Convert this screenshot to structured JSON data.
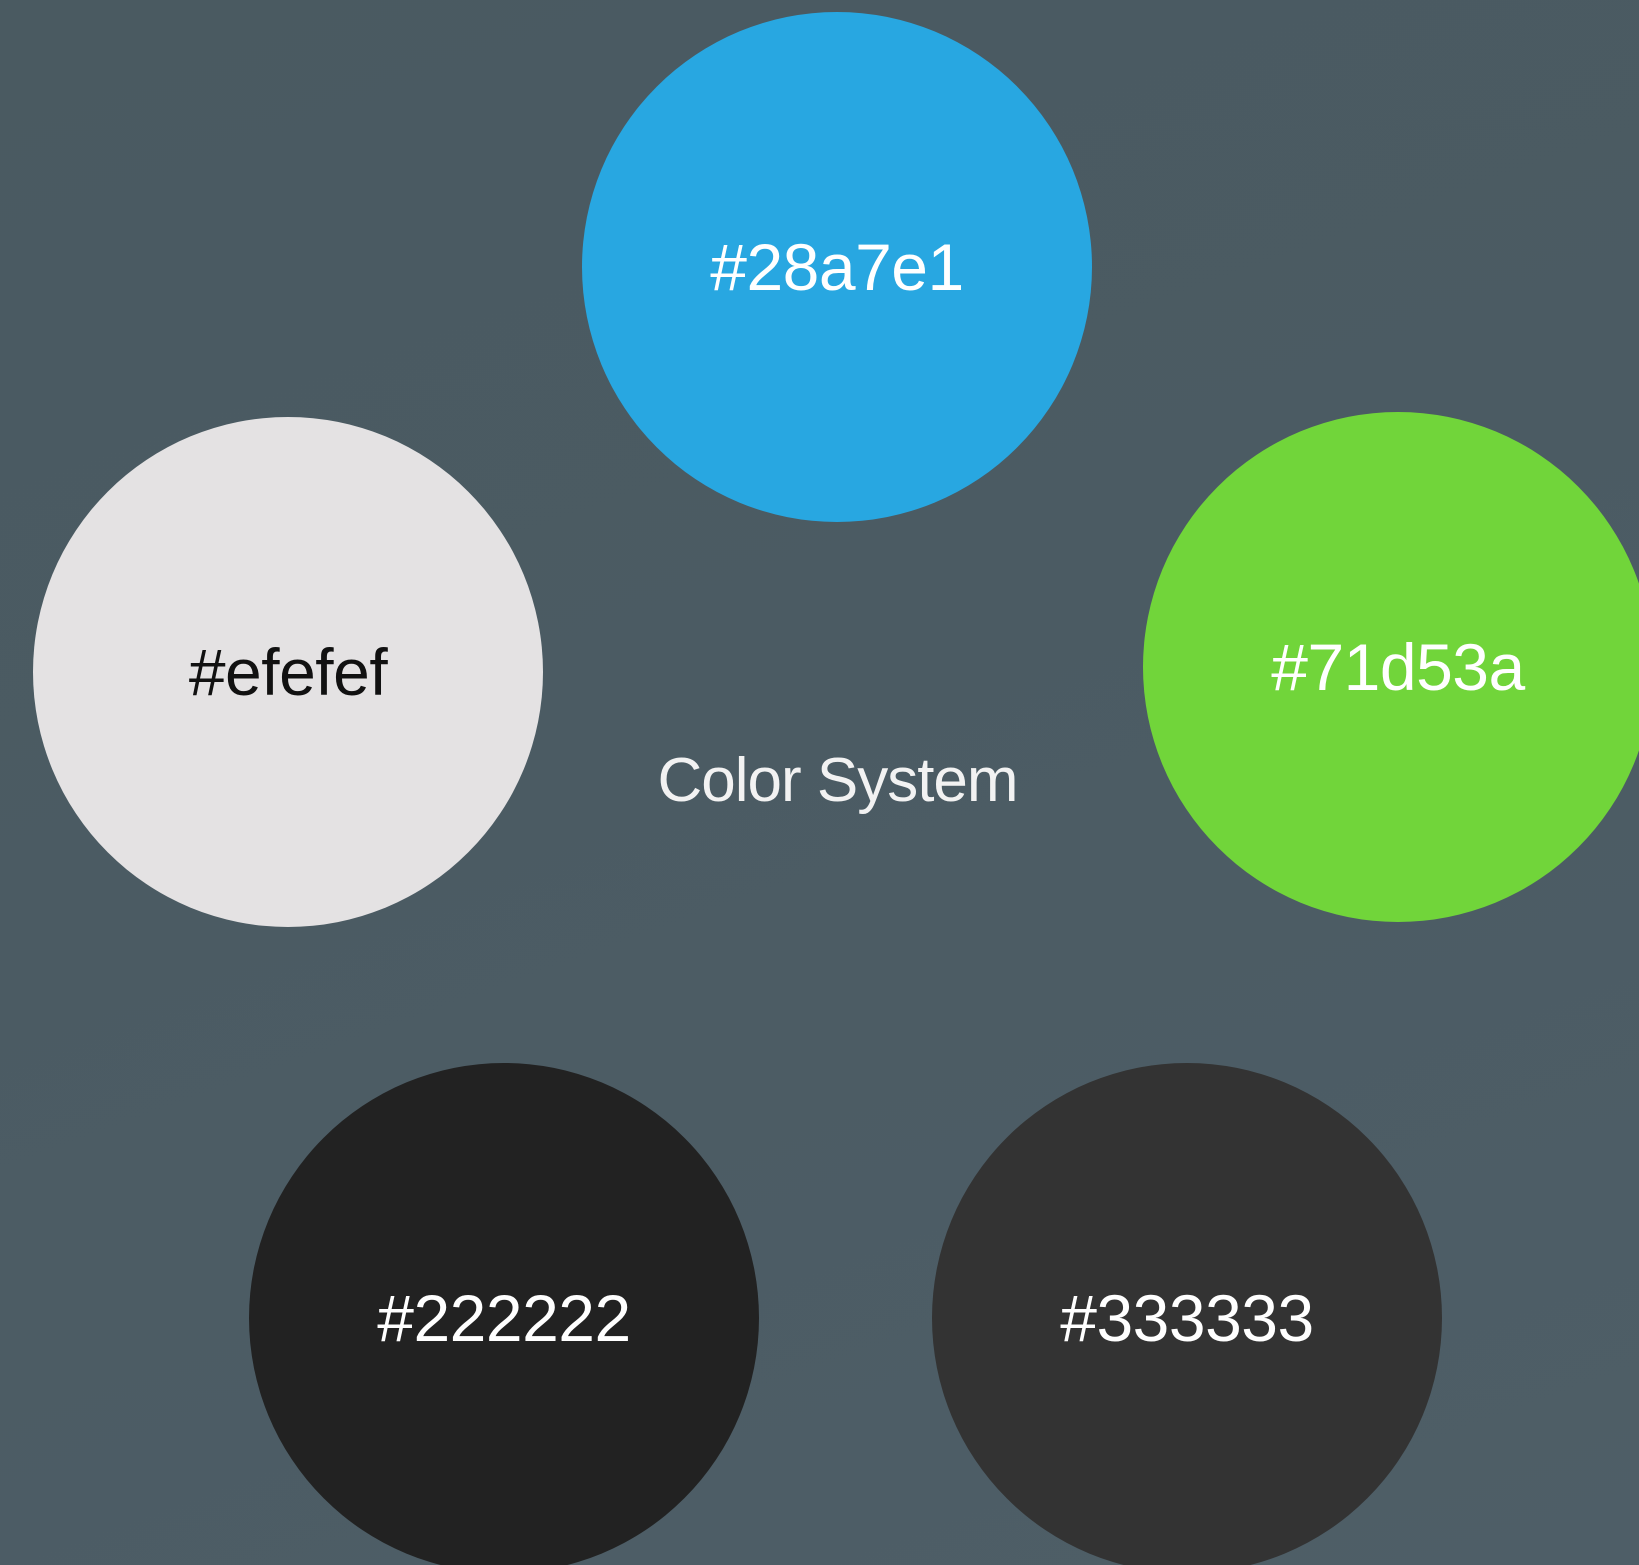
{
  "title": "Color System",
  "swatches": [
    {
      "label": "#28a7e1",
      "color": "#28a7e1"
    },
    {
      "label": "#efefef",
      "color": "#efefef"
    },
    {
      "label": "#71d53a",
      "color": "#71d53a"
    },
    {
      "label": "#222222",
      "color": "#222222"
    },
    {
      "label": "#333333",
      "color": "#333333"
    }
  ]
}
